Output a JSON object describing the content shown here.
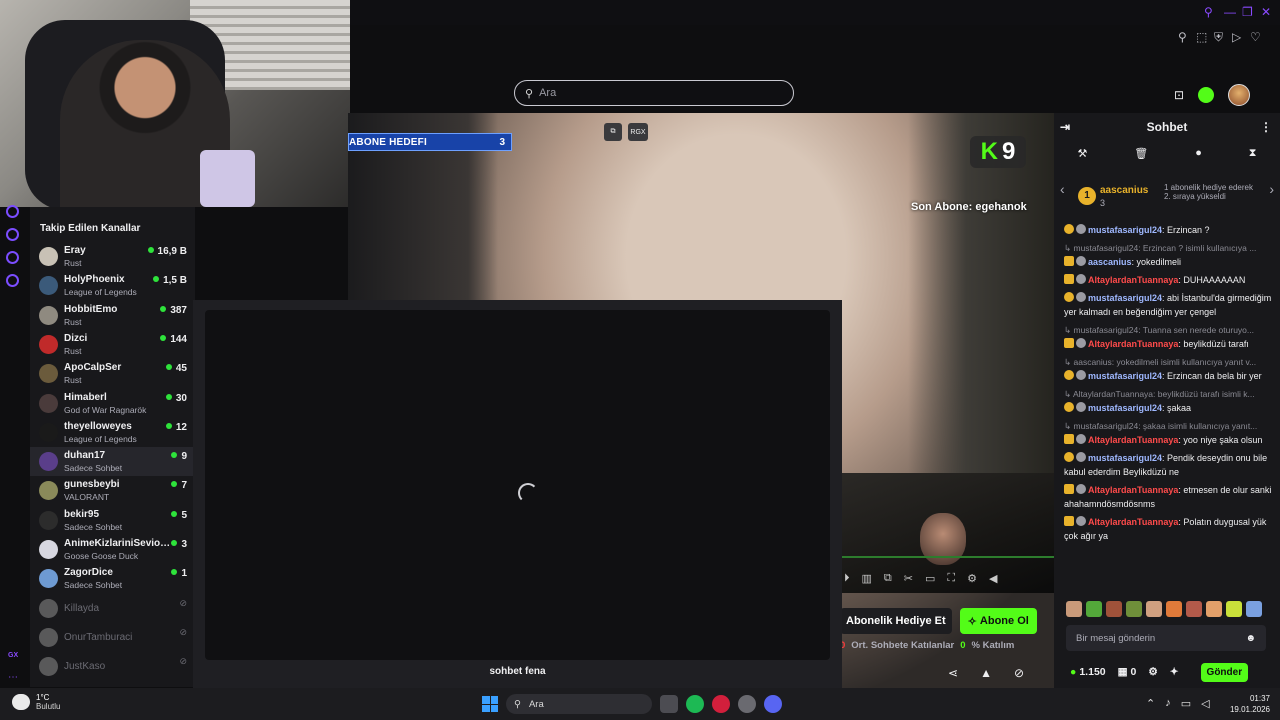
{
  "search": {
    "placeholder": "Ara"
  },
  "overlay": {
    "goal_label": "ABONE HEDEFI",
    "goal_count": "3",
    "k_viewer_count": "9",
    "last_sub": "Son Abone: egehanok",
    "chip_rgx": "RGX"
  },
  "sidebar": {
    "title": "Takip Edilen Kanallar",
    "channels": [
      {
        "name": "Eray",
        "game": "Rust",
        "viewers": "16,9 B",
        "color": "#c8c1b5"
      },
      {
        "name": "HolyPhoenix",
        "game": "League of Legends",
        "viewers": "1,5 B",
        "color": "#3b5a7a"
      },
      {
        "name": "HobbitEmo",
        "game": "Rust",
        "viewers": "387",
        "color": "#8f8a80"
      },
      {
        "name": "Dizci",
        "game": "Rust",
        "viewers": "144",
        "color": "#c02a2a"
      },
      {
        "name": "ApoCalpSer",
        "game": "Rust",
        "viewers": "45",
        "color": "#6b5b3c"
      },
      {
        "name": "Himaberl",
        "game": "God of War Ragnarök",
        "viewers": "30",
        "color": "#4a3b3b"
      },
      {
        "name": "theyelloweyes",
        "game": "League of Legends",
        "viewers": "12",
        "color": "#1a1a1a"
      },
      {
        "name": "duhan17",
        "game": "Sadece Sohbet",
        "viewers": "9",
        "color": "#5a3e8a"
      },
      {
        "name": "gunesbeybi",
        "game": "VALORANT",
        "viewers": "7",
        "color": "#8a8a5a"
      },
      {
        "name": "bekir95",
        "game": "Sadece Sohbet",
        "viewers": "5",
        "color": "#2c2c2c"
      },
      {
        "name": "AnimeKizlariniSeviorum",
        "game": "Goose Goose Duck",
        "viewers": "3",
        "color": "#d7d7e0"
      },
      {
        "name": "ZagorDice",
        "game": "Sadece Sohbet",
        "viewers": "1",
        "color": "#6e9ad2"
      }
    ],
    "offline": [
      {
        "name": "Killayda",
        "color": "#9a9a9a"
      },
      {
        "name": "OnurTamburaci",
        "color": "#9a9a9a"
      },
      {
        "name": "JustKaso",
        "color": "#9a9a9a"
      }
    ]
  },
  "modal": {
    "caption": "sohbet fena"
  },
  "stream_actions": {
    "gift_label": "Abonelik Hediye Et",
    "sub_label": "Abone Ol",
    "stat1_value": "0",
    "stat1_label": "Ort. Sohbete Katılanlar",
    "stat2_value": "0",
    "stat2_label": "% Katılım"
  },
  "chat": {
    "title": "Sohbet",
    "gift_user": "aascanius",
    "gift_level": "1",
    "gift_count": "3",
    "gift_text": "1 abonelik hediye ederek 2. sıraya yükseldi",
    "messages": [
      {
        "type": "msg",
        "user": "mustafasarigul24",
        "ucls": "u-blue",
        "badge": "one",
        "text": ": Erzincan ?"
      },
      {
        "type": "reply",
        "text": "mustafasarigul24: Erzincan ? isimli kullanıcıya ..."
      },
      {
        "type": "msg",
        "user": "aascanius",
        "ucls": "u-blue",
        "badge": "crown",
        "text": ": yokedilmeli"
      },
      {
        "type": "msg",
        "user": "AltaylardanTuannaya",
        "ucls": "u-red",
        "badge": "crown",
        "text": ": DUHAAAAAAN"
      },
      {
        "type": "msg",
        "user": "mustafasarigul24",
        "ucls": "u-blue",
        "badge": "one",
        "text": ": abi İstanbul'da girmediğim yer kalmadı en beğendiğim yer çengel"
      },
      {
        "type": "reply",
        "text": "mustafasarigul24: Tuanna sen nerede oturuyo..."
      },
      {
        "type": "msg",
        "user": "AltaylardanTuannaya",
        "ucls": "u-red",
        "badge": "crown",
        "text": ": beylikdüzü tarafı"
      },
      {
        "type": "reply",
        "text": "aascanius: yokedilmeli isimli kullanıcıya yanıt v..."
      },
      {
        "type": "msg",
        "user": "mustafasarigul24",
        "ucls": "u-blue",
        "badge": "one",
        "text": ": Erzincan da bela bir yer"
      },
      {
        "type": "reply",
        "text": "AltaylardanTuannaya: beylikdüzü tarafı isimli k..."
      },
      {
        "type": "msg",
        "user": "mustafasarigul24",
        "ucls": "u-blue",
        "badge": "one",
        "text": ": şakaa"
      },
      {
        "type": "reply",
        "text": "mustafasarigul24: şakaa isimli kullanıcıya yanıt..."
      },
      {
        "type": "msg",
        "user": "AltaylardanTuannaya",
        "ucls": "u-red",
        "badge": "crown",
        "text": ": yoo niye şaka olsun"
      },
      {
        "type": "msg",
        "user": "mustafasarigul24",
        "ucls": "u-blue",
        "badge": "one",
        "text": ": Pendik deseydin onu bile kabul ederdim Beylikdüzü ne"
      },
      {
        "type": "msg",
        "user": "AltaylardanTuannaya",
        "ucls": "u-red",
        "badge": "crown",
        "text": ": etmesen de olur sanki ahahamndösmdösnms"
      },
      {
        "type": "msg",
        "user": "AltaylardanTuannaya",
        "ucls": "u-red",
        "badge": "crown",
        "text": ": Polatın duygusal yük çok ağır ya"
      }
    ],
    "input_placeholder": "Bir mesaj gönderin",
    "points": "1.150",
    "other_count": "0",
    "send_label": "Gönder"
  },
  "taskbar": {
    "temp": "1°C",
    "weather": "Bulutlu",
    "search_label": "Ara",
    "time": "01:37",
    "date": "19.01.2026"
  },
  "colors": {
    "accent_green": "#53fc18",
    "accent_purple": "#8a4bff",
    "goal_blue": "#1843a8"
  }
}
